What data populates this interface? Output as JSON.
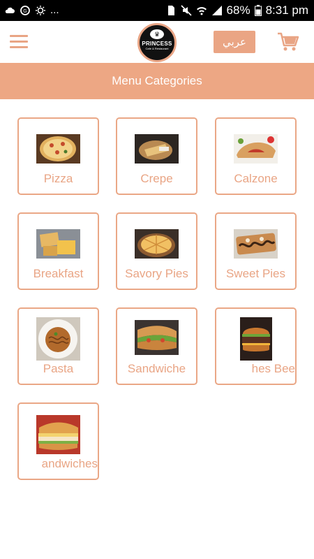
{
  "status_bar": {
    "battery": "68%",
    "time": "8:31 pm",
    "overflow": "..."
  },
  "header": {
    "logo_name": "PRINCESS",
    "logo_sub": "Cafe & Restaurant",
    "language_button": "عربي"
  },
  "title": "Menu Categories",
  "categories": [
    {
      "label": "Pizza",
      "icon": "pizza-image"
    },
    {
      "label": "Crepe",
      "icon": "crepe-image"
    },
    {
      "label": "Calzone",
      "icon": "calzone-image"
    },
    {
      "label": "Breakfast",
      "icon": "breakfast-image"
    },
    {
      "label": "Savory Pies",
      "icon": "savory-pies-image"
    },
    {
      "label": "Sweet Pies",
      "icon": "sweet-pies-image"
    },
    {
      "label": "Pasta",
      "icon": "pasta-image"
    },
    {
      "label": "Sandwiche",
      "icon": "sandwiches-image"
    },
    {
      "label": "hes     Bee",
      "icon": "burger-image"
    },
    {
      "label": "andwiches",
      "icon": "sub-sandwich-image"
    }
  ],
  "colors": {
    "accent": "#eda784",
    "label": "#e9a585",
    "status_bar": "#000000"
  }
}
